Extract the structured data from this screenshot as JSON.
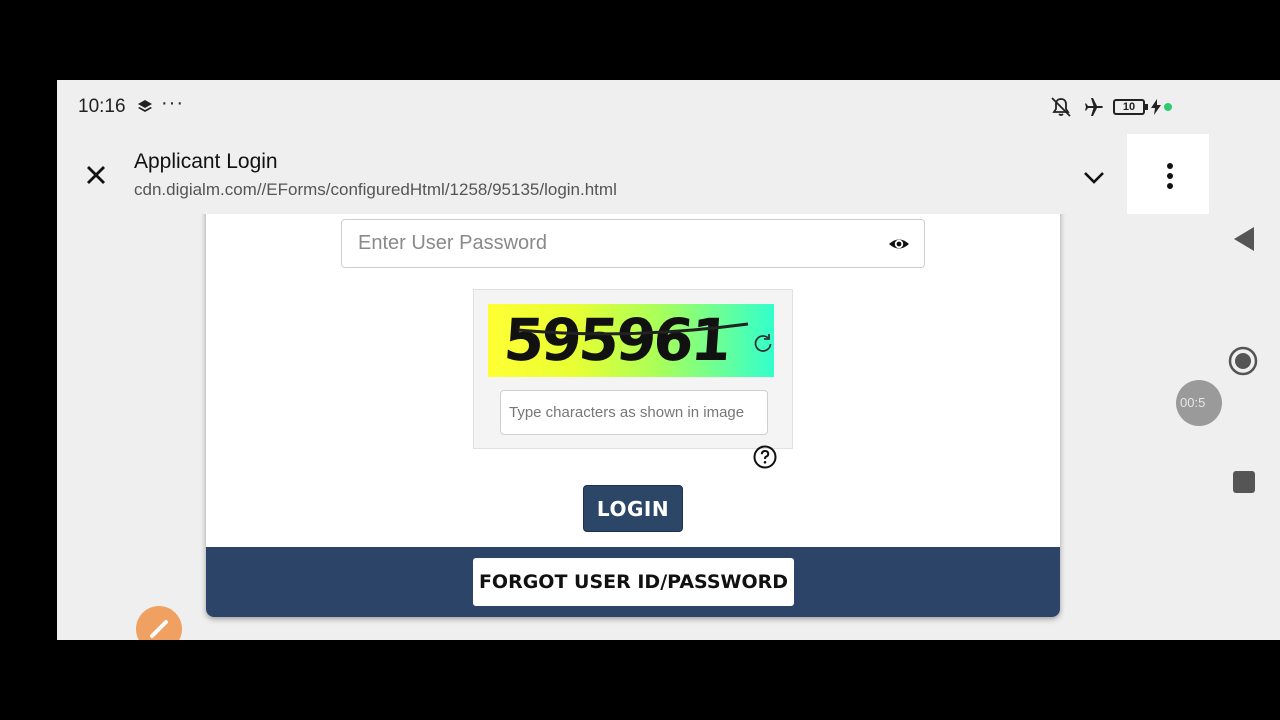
{
  "status_bar": {
    "time": "10:16",
    "dots": "···",
    "battery": "10"
  },
  "browser": {
    "title": "Applicant Login",
    "url": "cdn.digialm.com//EForms/configuredHtml/1258/95135/login.html"
  },
  "form": {
    "password_placeholder": "Enter User Password",
    "captcha_text": "595961",
    "captcha_placeholder": "Type characters as shown in image",
    "login_label": "LOGIN",
    "forgot_label": "FORGOT USER ID/PASSWORD"
  },
  "recorder": {
    "timer": "00:5"
  },
  "colors": {
    "primary": "#2c4668",
    "footer": "#2c4468",
    "fab": "#f0a060"
  }
}
